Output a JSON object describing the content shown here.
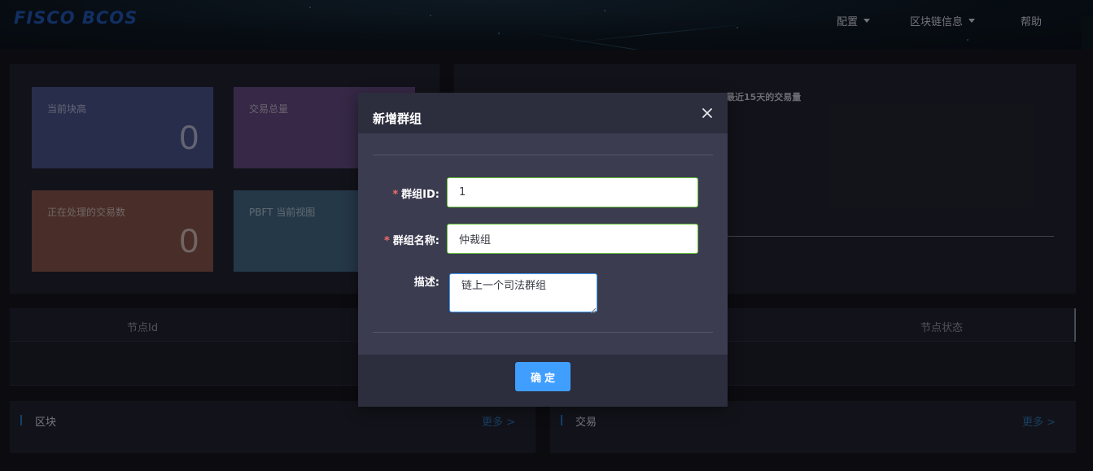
{
  "header": {
    "logo": "FISCO BCOS",
    "nav": [
      {
        "label": "配置",
        "has_dropdown": true
      },
      {
        "label": "区块链信息",
        "has_dropdown": true
      },
      {
        "label": "帮助",
        "has_dropdown": false
      }
    ]
  },
  "stats": [
    {
      "label": "当前块高",
      "value": "0",
      "color": "#484e83"
    },
    {
      "label": "交易总量",
      "value": "",
      "color": "#5d4579"
    },
    {
      "label": "正在处理的交易数",
      "value": "0",
      "color": "#7c4f47"
    },
    {
      "label": "PBFT 当前视图",
      "value": "",
      "color": "#40617d"
    }
  ],
  "chart": {
    "title": "最近15天的交易量"
  },
  "node_table": {
    "columns": [
      "节点Id",
      "节点状态"
    ]
  },
  "cards": [
    {
      "title": "区块",
      "more": "更多 >"
    },
    {
      "title": "交易",
      "more": "更多 >"
    }
  ],
  "dialog": {
    "title": "新增群组",
    "close_icon": "close-icon",
    "fields": {
      "group_id": {
        "label": "群组ID:",
        "value": "1",
        "required": true
      },
      "group_name": {
        "label": "群组名称:",
        "value": "仲裁组",
        "required": true
      },
      "description": {
        "label": "描述:",
        "value": "链上一个司法群组",
        "required": false
      }
    },
    "required_mark": "*",
    "confirm_label": "确定"
  }
}
